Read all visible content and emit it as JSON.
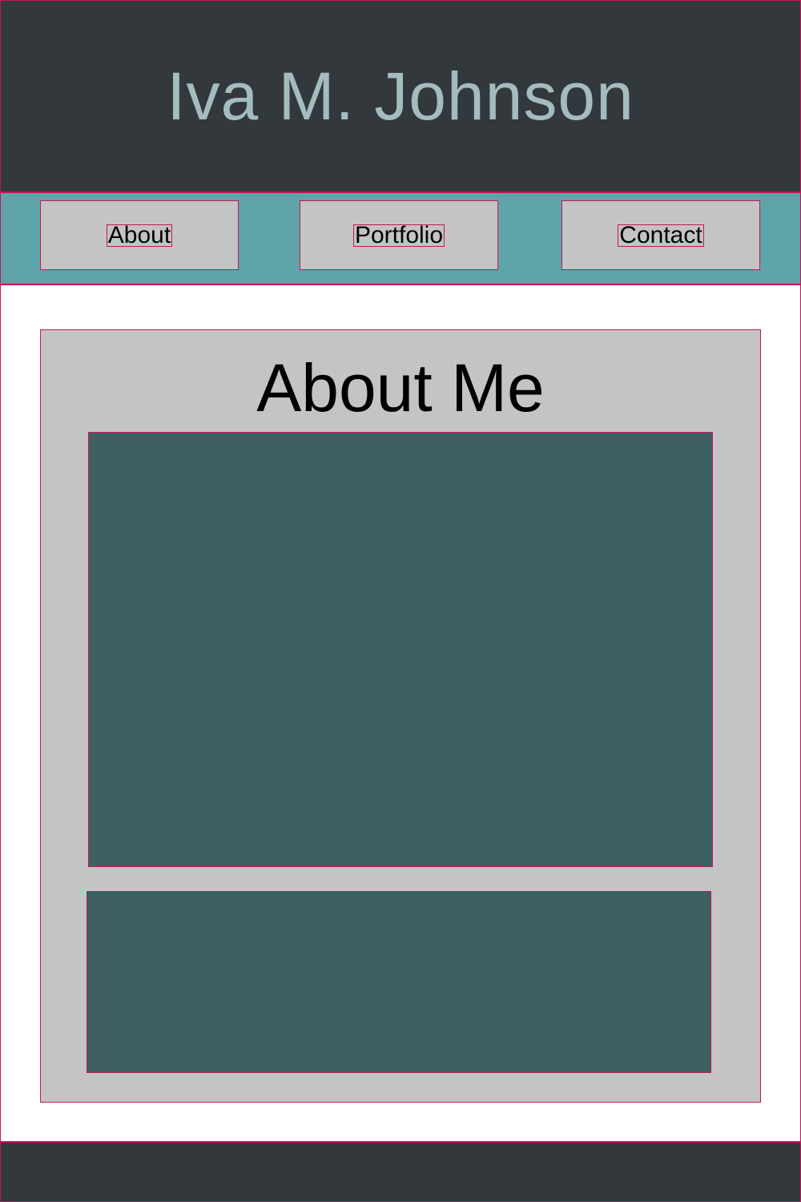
{
  "header": {
    "title": "Iva M. Johnson"
  },
  "nav": {
    "items": [
      {
        "label": "About"
      },
      {
        "label": "Portfolio"
      },
      {
        "label": "Contact"
      }
    ]
  },
  "main": {
    "about": {
      "heading": "About Me"
    }
  },
  "colors": {
    "header_bg": "#32383b",
    "header_text": "#a4bcbe",
    "nav_bg": "#5fa4a8",
    "card_bg": "#c4c4c4",
    "placeholder_bg": "#3e6062",
    "outline": "#c2185b"
  }
}
